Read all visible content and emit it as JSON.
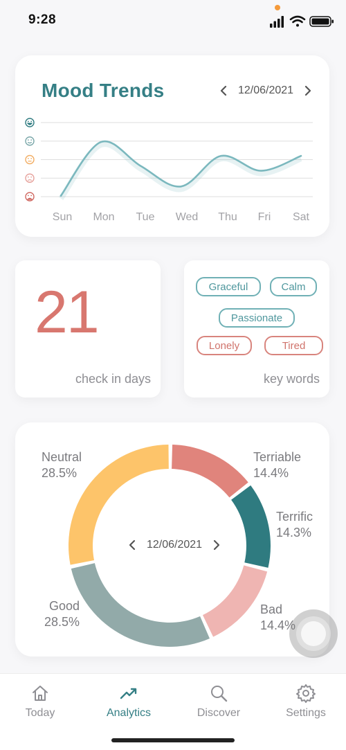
{
  "status": {
    "time": "9:28"
  },
  "mood_trends": {
    "title": "Mood Trends",
    "date": "12/06/2021",
    "mood_levels": [
      "very-happy-face-icon",
      "happy-face-icon",
      "neutral-face-icon",
      "sad-face-icon",
      "very-sad-face-icon"
    ],
    "days": [
      "Sun",
      "Mon",
      "Tue",
      "Wed",
      "Thu",
      "Fri",
      "Sat"
    ]
  },
  "chart_data": {
    "type": "line",
    "categories": [
      "Sun",
      "Mon",
      "Tue",
      "Wed",
      "Thu",
      "Fri",
      "Sat"
    ],
    "y_levels": [
      "very sad",
      "sad",
      "neutral",
      "happy",
      "very happy"
    ],
    "ylim": [
      1,
      5
    ],
    "values": [
      1.05,
      3.95,
      2.65,
      1.55,
      3.2,
      2.4,
      3.2
    ],
    "color": "#7bb8be"
  },
  "checkin": {
    "number": "21",
    "label": "check in days"
  },
  "keywords": {
    "tags": [
      {
        "label": "Graceful",
        "tone": "teal"
      },
      {
        "label": "Calm",
        "tone": "teal"
      },
      {
        "label": "Passionate",
        "tone": "teal"
      },
      {
        "label": "Lonely",
        "tone": "red"
      },
      {
        "label": "Tired",
        "tone": "red"
      }
    ],
    "label": "key words"
  },
  "mood_distribution": {
    "date": "12/06/2021",
    "slices": [
      {
        "name": "Neutral",
        "percent": "28.5%",
        "value": 28.5,
        "color": "#fdc46a"
      },
      {
        "name": "Terriable",
        "percent": "14.4%",
        "value": 14.4,
        "color": "#e0847c"
      },
      {
        "name": "Terrific",
        "percent": "14.3%",
        "value": 14.3,
        "color": "#2f7b80"
      },
      {
        "name": "Bad",
        "percent": "14.4%",
        "value": 14.4,
        "color": "#efb5b2"
      },
      {
        "name": "Good",
        "percent": "28.5%",
        "value": 28.5,
        "color": "#92aaa9"
      }
    ]
  },
  "tabs": [
    {
      "label": "Today",
      "icon": "home-icon",
      "active": false
    },
    {
      "label": "Analytics",
      "icon": "trend-icon",
      "active": true
    },
    {
      "label": "Discover",
      "icon": "search-icon",
      "active": false
    },
    {
      "label": "Settings",
      "icon": "gear-icon",
      "active": false
    }
  ]
}
